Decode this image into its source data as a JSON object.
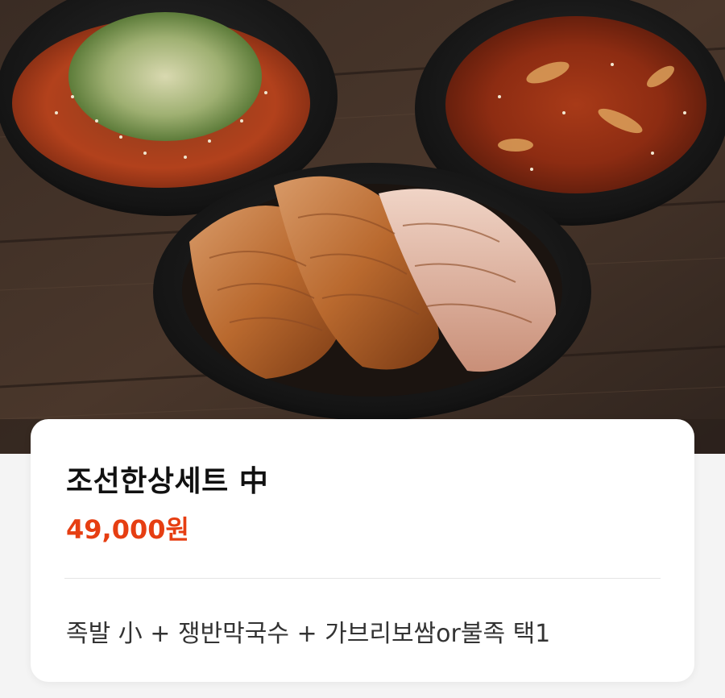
{
  "product": {
    "image_alt": "조선한상세트 中",
    "name": "조선한상세트 中",
    "price": "49,000원",
    "description": "족발 小 + 쟁반막국수 + 가브리보쌈or불족 택1"
  },
  "colors": {
    "price": "#e63e12",
    "title": "#111111",
    "description": "#333333",
    "card_bg": "#ffffff",
    "page_bg": "#f4f4f4"
  }
}
